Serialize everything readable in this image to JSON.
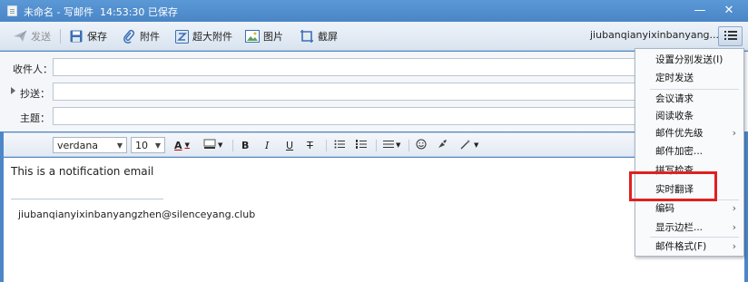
{
  "window": {
    "title": "未命名 - 写邮件",
    "saved_status": "14:53:30 已保存",
    "minimize": "—",
    "close": "✕"
  },
  "toolbar": {
    "send": "发送",
    "save": "保存",
    "attach": "附件",
    "big_attach": "超大附件",
    "image": "图片",
    "screenshot": "截屏",
    "account": "jiubanqianyixinbanyang... ⌄"
  },
  "fields": {
    "to_label": "收件人：",
    "cc_label": "抄送：",
    "subject_label": "主题："
  },
  "format": {
    "font": "verdana",
    "size": "10"
  },
  "body": {
    "text": "This is a notification email",
    "signature": "jiubanqianyixinbanyangzhen@silenceyang.club"
  },
  "menu": {
    "items": [
      "设置分别发送(I)",
      "定时发送",
      "会议请求",
      "阅读收条",
      "邮件优先级",
      "邮件加密...",
      "拼写检查",
      "实时翻译",
      "编码",
      "显示边栏...",
      "邮件格式(F)"
    ]
  },
  "colors": {
    "accent": "#4a86c6",
    "highlight": "#e02020"
  }
}
